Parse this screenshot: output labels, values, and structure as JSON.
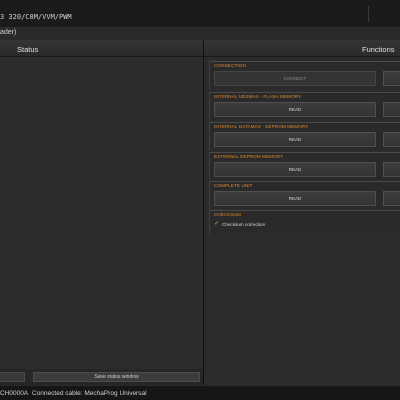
{
  "window": {
    "title": "3 320/C8M/VVM/PWM"
  },
  "menubar": {
    "crumb": "ader)"
  },
  "status_panel": {
    "header": "Status",
    "save_button": "Save status window"
  },
  "functions_panel": {
    "header": "Functions",
    "groups": [
      {
        "title": "CONNECTION",
        "button": "CONNECT"
      },
      {
        "title": "INTERNAL UDSMAX - FLASH MEMORY",
        "button": "READ"
      },
      {
        "title": "INTERNAL DATAMAX - EEPROM MEMORY",
        "button": "READ"
      },
      {
        "title": "EXTERNAL EEPROM MEMORY",
        "button": "READ"
      },
      {
        "title": "COMPLETE UNIT",
        "button": "READ"
      },
      {
        "title": "CHECKSUM",
        "checkbox_label": "Checksum correction",
        "checked": true
      }
    ]
  },
  "statusbar": {
    "device": "CH0000A",
    "cable": "Connected cable: MechaProg Universal"
  },
  "colors": {
    "accent": "#e08a2b",
    "background": "#2b2b2b"
  }
}
